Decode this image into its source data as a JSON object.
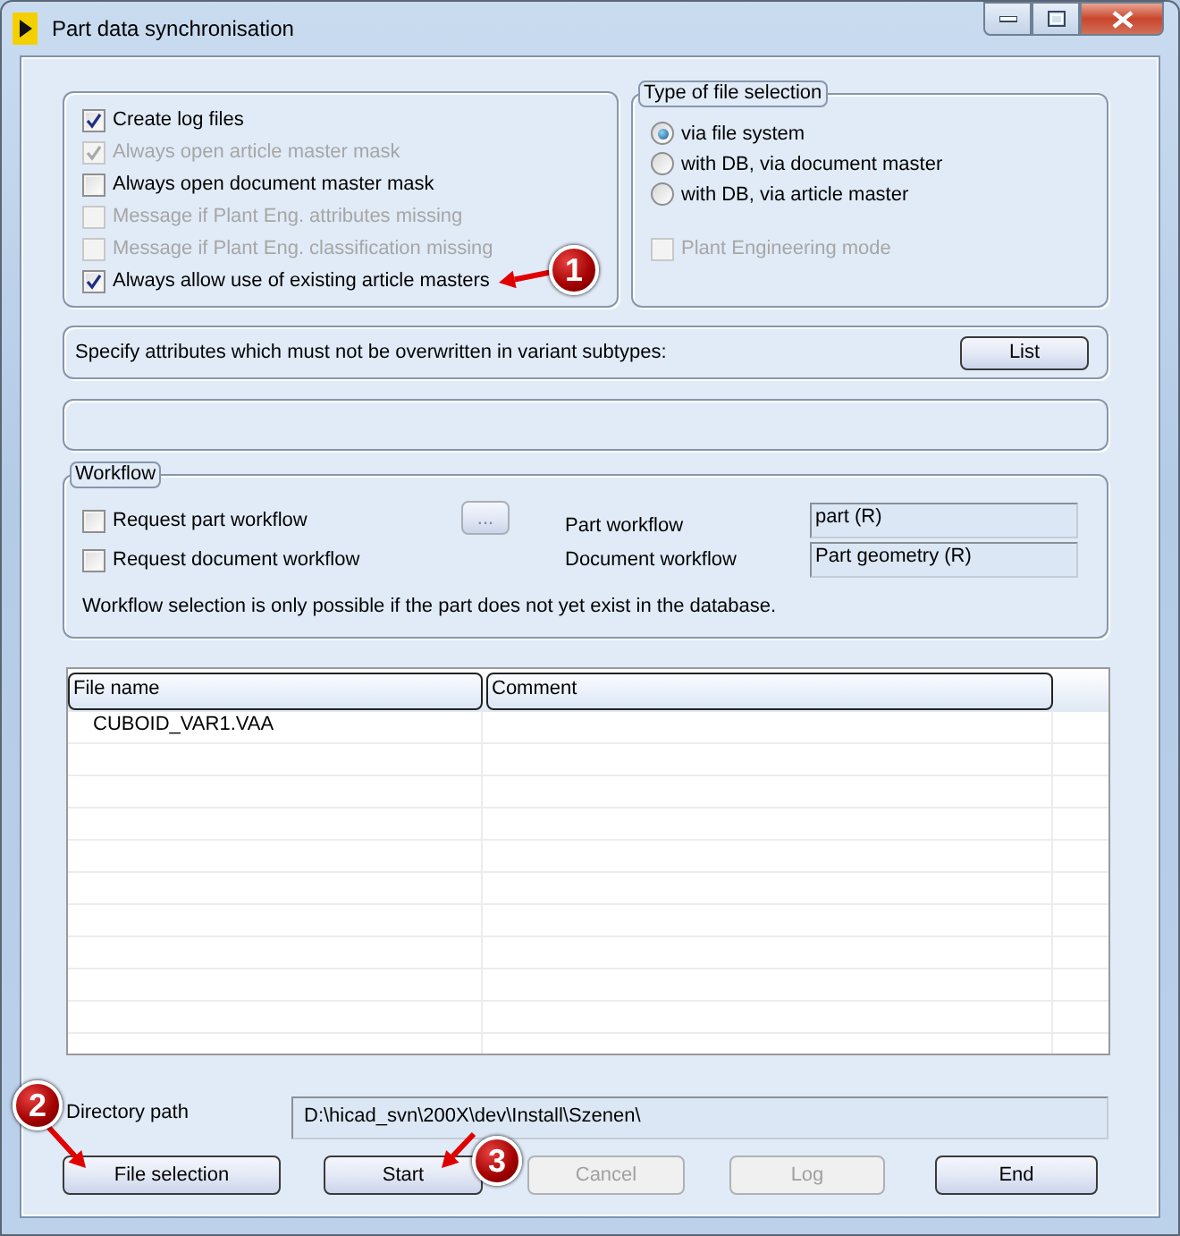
{
  "window": {
    "title": "Part data synchronisation"
  },
  "options": [
    {
      "label": "Create log files",
      "checked": true,
      "disabled": false
    },
    {
      "label": "Always open article master mask",
      "checked": true,
      "disabled": true
    },
    {
      "label": "Always open document master mask",
      "checked": false,
      "disabled": false
    },
    {
      "label": "Message if Plant Eng. attributes missing",
      "checked": false,
      "disabled": true
    },
    {
      "label": "Message if Plant Eng. classification missing",
      "checked": false,
      "disabled": true
    },
    {
      "label": "Always allow use of existing article masters",
      "checked": true,
      "disabled": false
    }
  ],
  "file_selection": {
    "title": "Type of file selection",
    "options": [
      {
        "label": "via file system",
        "selected": true
      },
      {
        "label": "with DB, via document master",
        "selected": false
      },
      {
        "label": "with DB, via article master",
        "selected": false
      }
    ],
    "plant_engineering_mode": {
      "label": "Plant Engineering mode",
      "checked": false,
      "disabled": true
    }
  },
  "attributes": {
    "text": "Specify attributes which must not be overwritten in variant subtypes:",
    "button": "List"
  },
  "workflow": {
    "title": "Workflow",
    "requests": [
      {
        "label": "Request part workflow",
        "checked": false
      },
      {
        "label": "Request document workflow",
        "checked": false
      }
    ],
    "browse_button": "...",
    "fields": [
      {
        "label": "Part workflow",
        "value": "part (R)"
      },
      {
        "label": "Document workflow",
        "value": "Part geometry (R)"
      }
    ],
    "note": "Workflow selection is only possible if the part does not yet exist in the database."
  },
  "table": {
    "columns": [
      "File name",
      "Comment"
    ],
    "rows": [
      {
        "file_name": "CUBOID_VAR1.VAA"
      }
    ]
  },
  "directory": {
    "label": "Directory path",
    "value": "D:\\hicad_svn\\200X\\dev\\Install\\Szenen\\"
  },
  "buttons": [
    {
      "label": "File selection",
      "disabled": false
    },
    {
      "label": "Start",
      "disabled": false
    },
    {
      "label": "Cancel",
      "disabled": true
    },
    {
      "label": "Log",
      "disabled": true
    },
    {
      "label": "End",
      "disabled": false
    }
  ],
  "callouts": [
    {
      "number": "1"
    },
    {
      "number": "2"
    },
    {
      "number": "3"
    }
  ]
}
